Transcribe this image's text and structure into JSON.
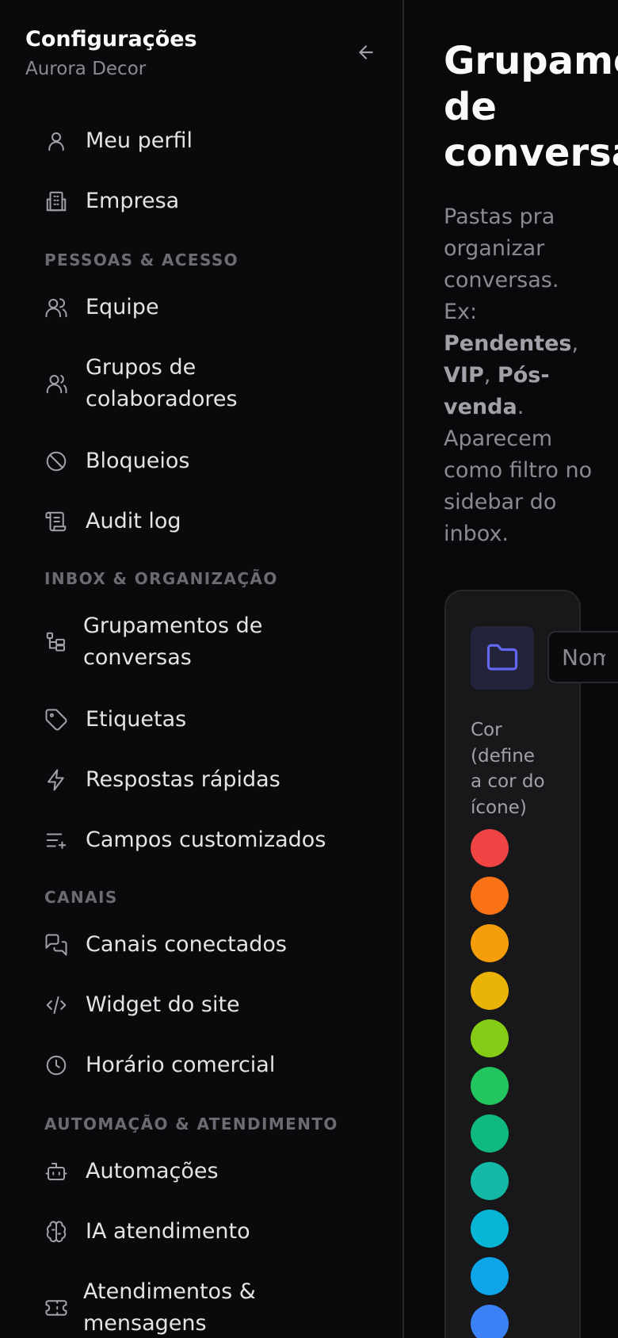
{
  "sidebar": {
    "title": "Configurações",
    "subtitle": "Aurora Decor",
    "items": [
      {
        "label": "Meu perfil",
        "icon": "user-icon"
      },
      {
        "label": "Empresa",
        "icon": "building-icon"
      },
      {
        "label": "Equipe",
        "icon": "users-icon"
      },
      {
        "label": "Grupos de colaboradores",
        "icon": "users-group-icon"
      },
      {
        "label": "Bloqueios",
        "icon": "ban-icon"
      },
      {
        "label": "Audit log",
        "icon": "scroll-icon"
      },
      {
        "label": "Grupamentos de conversas",
        "icon": "folder-tree-icon"
      },
      {
        "label": "Etiquetas",
        "icon": "tag-icon"
      },
      {
        "label": "Respostas rápidas",
        "icon": "zap-icon"
      },
      {
        "label": "Campos customizados",
        "icon": "list-plus-icon"
      },
      {
        "label": "Canais conectados",
        "icon": "messages-icon"
      },
      {
        "label": "Widget do site",
        "icon": "code-icon"
      },
      {
        "label": "Horário comercial",
        "icon": "clock-icon"
      },
      {
        "label": "Automações",
        "icon": "bot-icon"
      },
      {
        "label": "IA atendimento",
        "icon": "brain-icon"
      },
      {
        "label": "Atendimentos & mensagens",
        "icon": "ticket-icon"
      }
    ],
    "sections": [
      "PESSOAS & ACESSO",
      "INBOX & ORGANIZAÇÃO",
      "CANAIS",
      "AUTOMAÇÃO & ATENDIMENTO"
    ]
  },
  "main": {
    "title_lines": [
      "Grupamentos",
      "de",
      "conversas"
    ],
    "description": {
      "intro": "Pastas pra organizar conversas. Ex:",
      "examples": [
        "Pendentes",
        "VIP",
        "Pós-venda"
      ],
      "outro": "Aparecem como filtro no sidebar do inbox."
    },
    "form": {
      "name_placeholder": "Nome",
      "color_label": "Cor (define a cor do ícone)",
      "folder_icon": "folder-icon",
      "folder_color": "#6366f1",
      "colors": [
        "#ef4444",
        "#f97316",
        "#f59e0b",
        "#eab308",
        "#84cc16",
        "#22c55e",
        "#10b981",
        "#14b8a6",
        "#06b6d4",
        "#0ea5e9",
        "#3b82f6"
      ]
    }
  }
}
